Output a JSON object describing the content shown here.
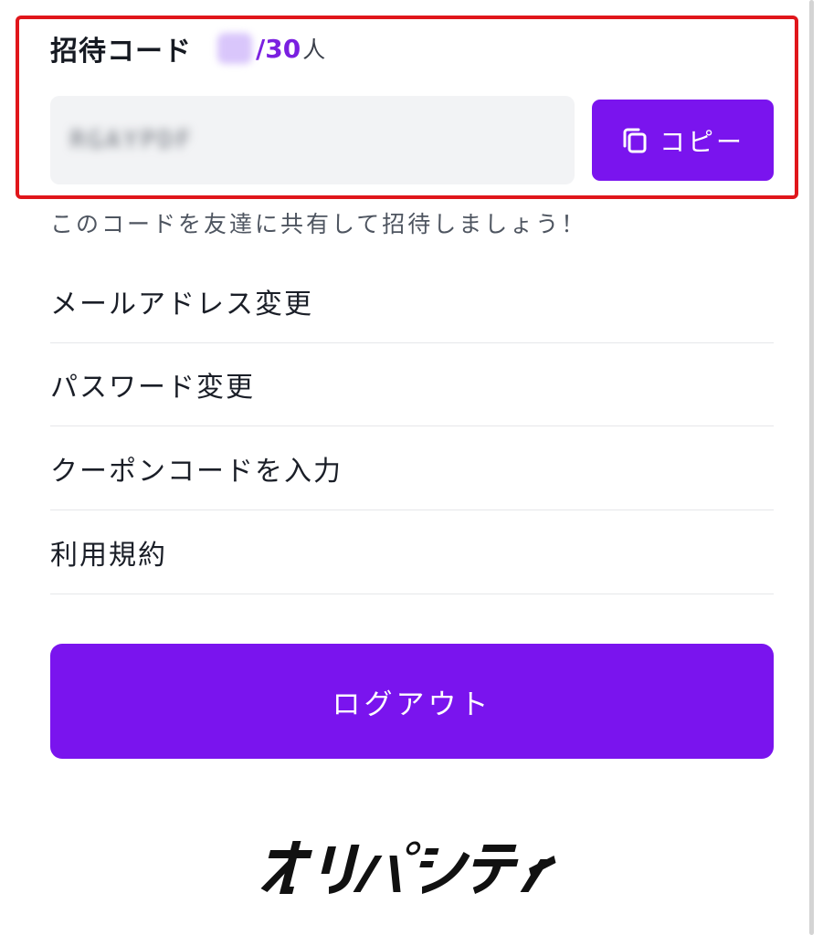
{
  "invite": {
    "title": "招待コード",
    "count_total": "/30",
    "count_unit": "人",
    "code_value": "RGAYPDF",
    "copy_label": "コピー",
    "hint": "このコードを友達に共有して招待しましょう！"
  },
  "menu": {
    "items": [
      {
        "label": "メールアドレス変更"
      },
      {
        "label": "パスワード変更"
      },
      {
        "label": "クーポンコードを入力"
      },
      {
        "label": "利用規約"
      }
    ]
  },
  "logout": {
    "label": "ログアウト"
  },
  "brand": {
    "logo_text": "オリパシティ"
  },
  "colors": {
    "accent": "#7a14ee",
    "highlight_border": "#e0161b",
    "field_bg": "#f2f3f5"
  },
  "icons": {
    "copy": "copy-icon"
  }
}
